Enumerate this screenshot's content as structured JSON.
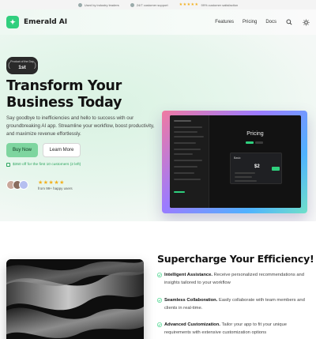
{
  "topbar": {
    "items": [
      {
        "icon": "check-circle-icon",
        "text": "Used by industry leaders"
      },
      {
        "icon": "check-circle-icon",
        "text": "24/7 customer support"
      },
      {
        "icon": "star-icon",
        "stars": "★★★★★",
        "text": "99% customer satisfaction"
      }
    ]
  },
  "nav": {
    "logo_glyph": "✦",
    "brand": "Emerald AI",
    "links": [
      "Features",
      "Pricing",
      "Docs"
    ],
    "accent": "#2fcf7d"
  },
  "hero": {
    "badge_top": "Product of the Day",
    "badge_rank": "1st",
    "headline_line1": "Transform Your",
    "headline_line2": "Business Today",
    "subtitle": "Say goodbye to inefficiencies and hello to success with our groundbreaking AI app. Streamline your workflow, boost productivity, and maximize revenue effortlessly.",
    "primary_button": "Buy Now",
    "secondary_button": "Learn More",
    "promo": "$350 off for the first 10 customers (2 left)",
    "rating_stars": "★★★★★",
    "rating_text": "from 99+ happy users",
    "avatar_colors": [
      "#c9a79a",
      "#8a6c5e",
      "#b5bff0"
    ],
    "mockup": {
      "title": "Pricing",
      "card_label": "Basic",
      "price": "$2"
    }
  },
  "section2": {
    "title": "Supercharge Your Efficiency!",
    "features": [
      {
        "title": "Intelligent Assistance.",
        "text": "Receive personalized recommendations and insights tailored to your workflow"
      },
      {
        "title": "Seamless Collaboration.",
        "text": "Easily collaborate with team members and clients in real-time."
      },
      {
        "title": "Advanced Customization.",
        "text": "Tailor your app to fit your unique requirements with extensive customization options"
      }
    ]
  }
}
